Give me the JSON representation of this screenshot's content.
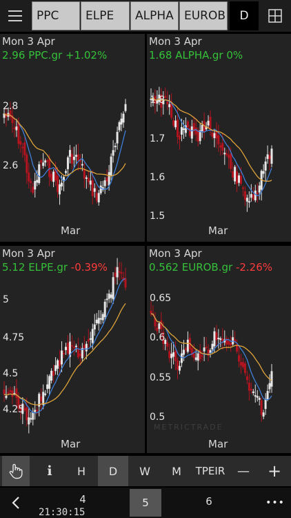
{
  "top_bar": {
    "menu_icon": "hamburger-menu-icon",
    "symbols": [
      "PPC",
      "ELPE",
      "ALPHA",
      "EUROB"
    ],
    "period_label": "D",
    "grid_icon": "grid-layout-icon"
  },
  "panels": [
    {
      "date": "Mon 3 Apr",
      "price": "2.96",
      "ticker": "PPC.gr",
      "change": "+1.02%",
      "change_color": "#35c23a",
      "y_ticks": [
        "2.8",
        "2.6"
      ],
      "x_label": "Mar"
    },
    {
      "date": "Mon 3 Apr",
      "price": "1.68",
      "ticker": "ALPHA.gr",
      "change": "0%",
      "change_color": "#35c23a",
      "y_ticks": [
        "1.8",
        "1.7",
        "1.6",
        "1.5"
      ],
      "x_label": "Mar"
    },
    {
      "date": "Mon 3 Apr",
      "price": "5.12",
      "ticker": "ELPE.gr",
      "change": "-0.39%",
      "change_color": "#ff3b3b",
      "y_ticks": [
        "5",
        "4.75",
        "4.5",
        "4.25"
      ],
      "x_label": "Mar"
    },
    {
      "date": "Mon 3 Apr",
      "price": "0.562",
      "ticker": "EUROB.gr",
      "change": "-2.26%",
      "change_color": "#ff3b3b",
      "y_ticks": [
        "0.65",
        "0.6",
        "0.55",
        "0.5"
      ],
      "x_label": "Mar",
      "watermark": "METRICTRADE"
    }
  ],
  "toolbar": {
    "hand_icon": "hand-pointer-icon",
    "info_label": "i",
    "periods": [
      "H",
      "D",
      "W",
      "M"
    ],
    "exchange": "TPEIR",
    "zoom_out": "—",
    "zoom_in": "+"
  },
  "bottom_bar": {
    "back_icon": "chevron-left-icon",
    "pages": [
      "4",
      "5",
      "6"
    ],
    "time": "21:30:15",
    "more_label": "•••"
  },
  "colors": {
    "up_candle": "#e6e6e6",
    "down_candle": "#b3141f",
    "ma_fast": "#3f7fd9",
    "ma_slow": "#e0a43a"
  }
}
